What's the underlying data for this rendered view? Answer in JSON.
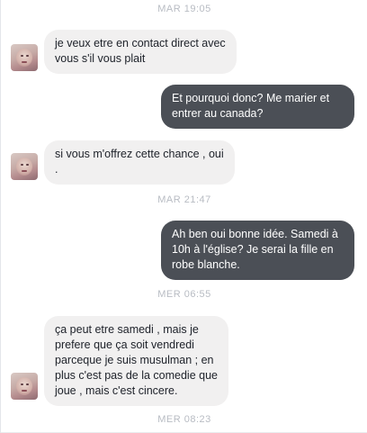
{
  "conversation": {
    "timestamps": [
      "MAR 19:05",
      "MAR 21:47",
      "MER 06:55",
      "MER 08:23"
    ],
    "messages": [
      {
        "sender": "contact",
        "lines": [
          "je veux etre en contact direct avec",
          "vous s'il vous plait"
        ]
      },
      {
        "sender": "me",
        "lines": [
          "Et pourquoi donc? Me marier et",
          "entrer au canada?"
        ]
      },
      {
        "sender": "contact",
        "lines": [
          "si vous m'offrez cette chance , oui",
          "."
        ]
      },
      {
        "sender": "me",
        "lines": [
          "Ah ben oui bonne idée. Samedi à",
          "10h à l'église? Je serai la fille en",
          "robe blanche."
        ]
      },
      {
        "sender": "contact",
        "lines": [
          "ça peut etre samedi , mais je",
          "prefere que  ça soit  vendredi",
          "parceque je suis musulman ; en",
          "plus c'est pas de la comedie que",
          "joue , mais c'est cincere."
        ]
      }
    ]
  },
  "colors": {
    "incoming_bubble": "#f1f0f0",
    "outgoing_bubble": "#4b4f56",
    "timestamp_text": "#b8bcc3"
  }
}
